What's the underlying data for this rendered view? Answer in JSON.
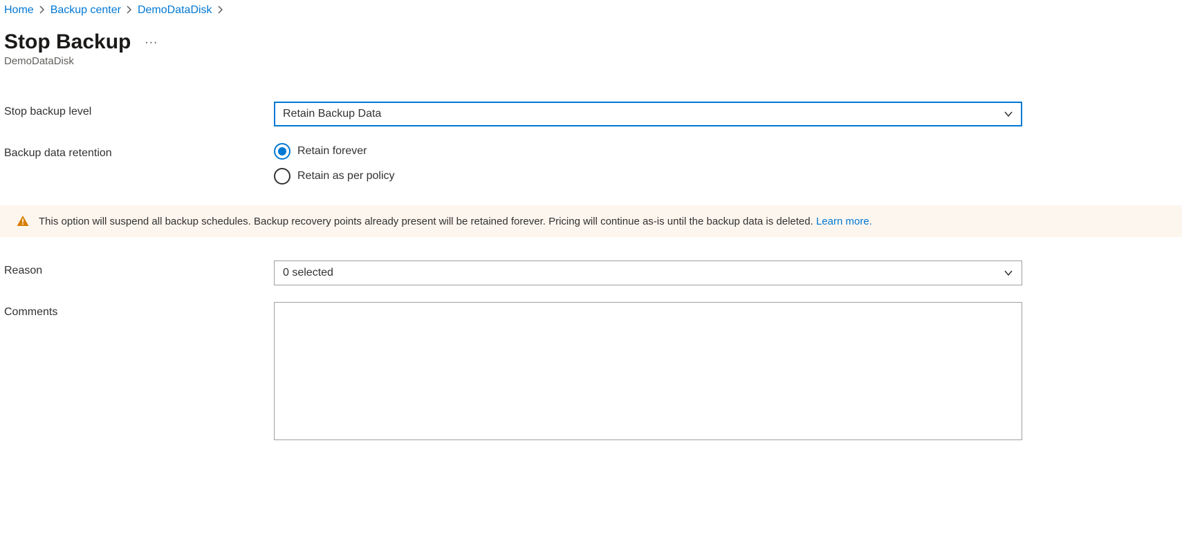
{
  "breadcrumb": {
    "items": [
      {
        "label": "Home"
      },
      {
        "label": "Backup center"
      },
      {
        "label": "DemoDataDisk"
      }
    ]
  },
  "page": {
    "title": "Stop Backup",
    "subtitle": "DemoDataDisk"
  },
  "form": {
    "stop_backup_level": {
      "label": "Stop backup level",
      "value": "Retain Backup Data"
    },
    "backup_data_retention": {
      "label": "Backup data retention",
      "options": [
        {
          "label": "Retain forever",
          "selected": true
        },
        {
          "label": "Retain as per policy",
          "selected": false
        }
      ]
    },
    "reason": {
      "label": "Reason",
      "value": "0 selected"
    },
    "comments": {
      "label": "Comments",
      "value": ""
    }
  },
  "banner": {
    "text": "This option will suspend all backup schedules. Backup recovery points already present will be retained forever. Pricing will continue as-is until the backup data is deleted. ",
    "link_text": "Learn more."
  }
}
